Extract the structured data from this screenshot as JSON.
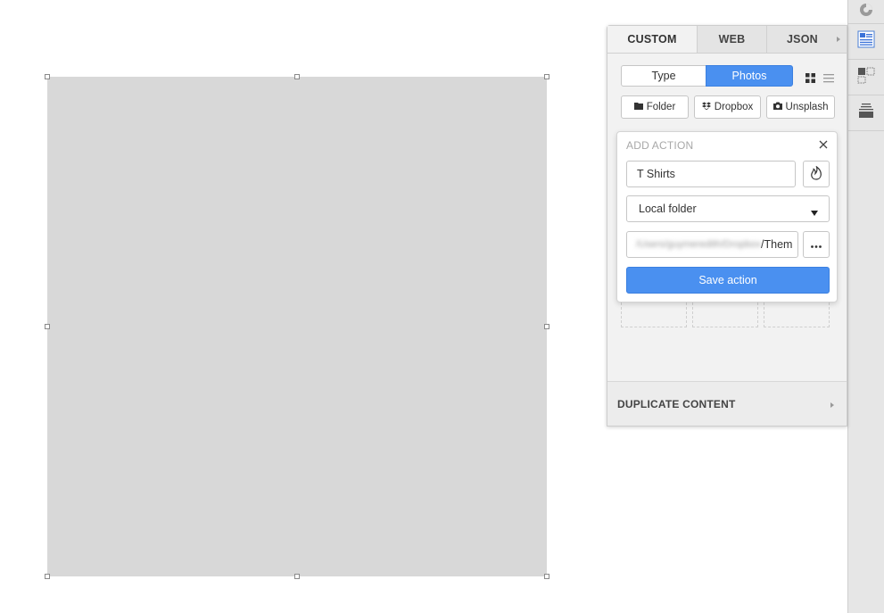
{
  "panel": {
    "tabs": [
      "CUSTOM",
      "WEB",
      "JSON"
    ],
    "segment": {
      "type_label": "Type",
      "photos_label": "Photos",
      "selected": "Photos"
    },
    "sources": [
      "Folder",
      "Dropbox",
      "Unsplash"
    ],
    "duplicate_label": "DUPLICATE CONTENT"
  },
  "popover": {
    "title": "ADD ACTION",
    "name_value": "T Shirts",
    "source_select": "Local folder",
    "path_visible_suffix": "/Them",
    "path_prefix_blurred": "/Users/guymeredith/Dropbox",
    "save_label": "Save action"
  },
  "colors": {
    "accent": "#4a90f0",
    "artboard": "#d8d8d8",
    "panel_bg": "#f2f2f2",
    "toolbar_bg": "#e6e6e6"
  },
  "icons": {
    "toolbar": [
      "craft-logo-icon",
      "layout-panel-icon",
      "selection-icon",
      "layers-icon"
    ],
    "view": [
      "grid-view-icon",
      "list-view-icon"
    ],
    "sources": [
      "folder-icon",
      "dropbox-icon",
      "camera-icon"
    ]
  }
}
